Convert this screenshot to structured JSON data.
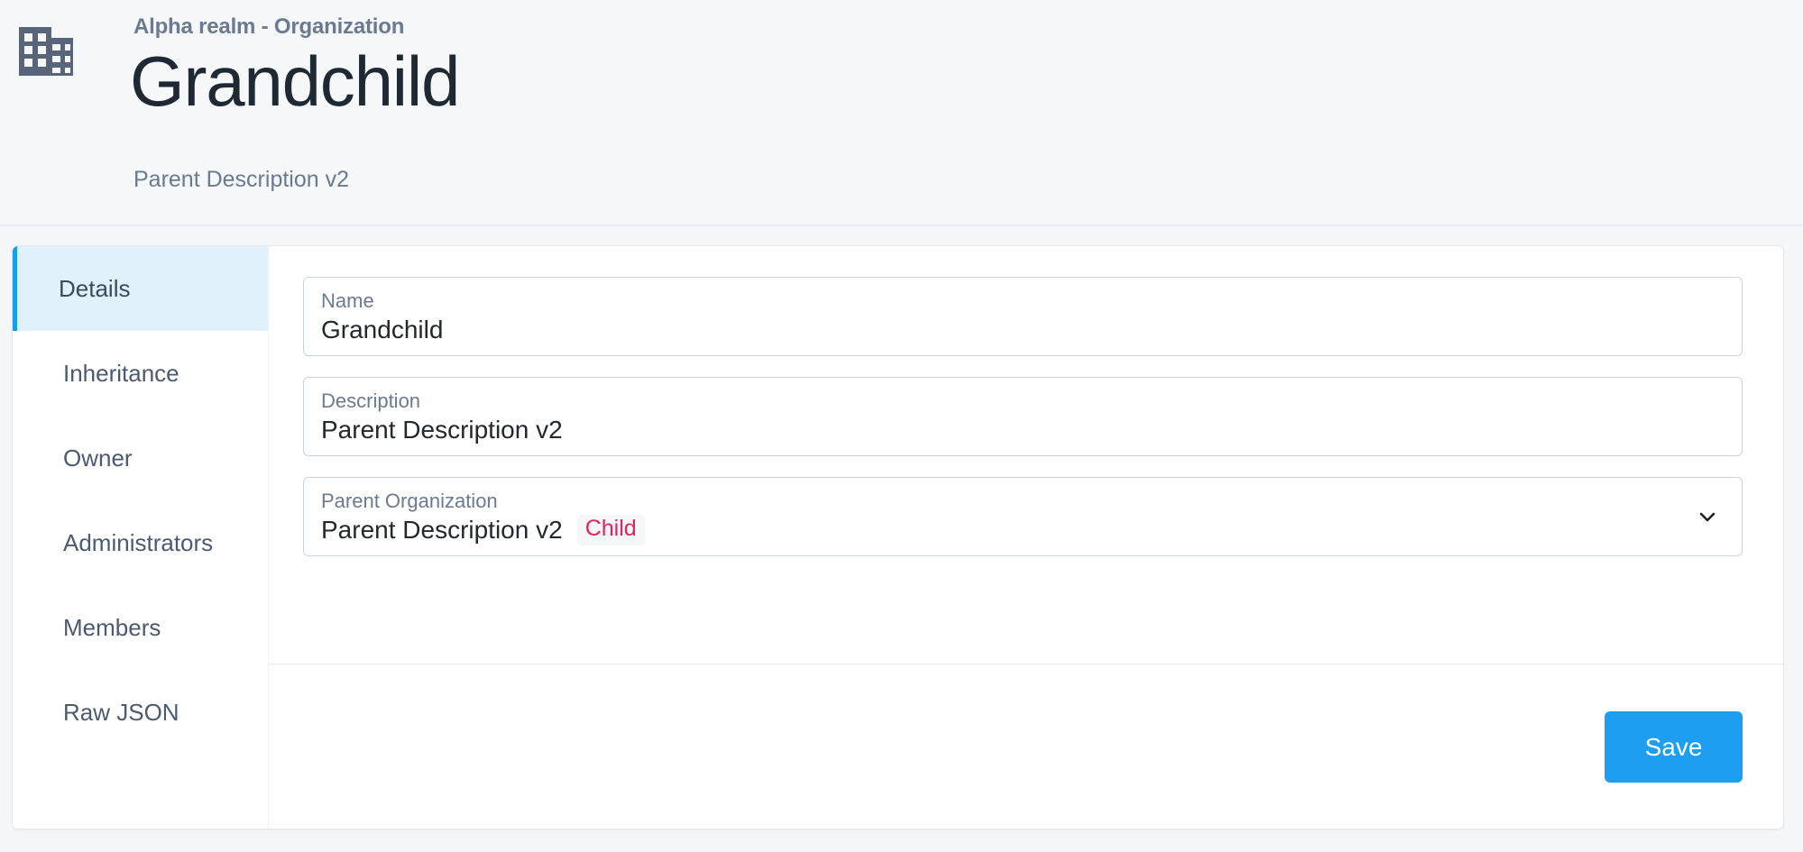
{
  "header": {
    "icon": "organization-building-icon",
    "breadcrumb": "Alpha realm - Organization",
    "title": "Grandchild",
    "subtitle": "Parent Description v2"
  },
  "sidebar": {
    "items": [
      {
        "label": "Details",
        "active": true
      },
      {
        "label": "Inheritance",
        "active": false
      },
      {
        "label": "Owner",
        "active": false
      },
      {
        "label": "Administrators",
        "active": false
      },
      {
        "label": "Members",
        "active": false
      },
      {
        "label": "Raw JSON",
        "active": false
      }
    ]
  },
  "form": {
    "name_field": {
      "label": "Name",
      "value": "Grandchild"
    },
    "description_field": {
      "label": "Description",
      "value": "Parent Description v2"
    },
    "parent_org_field": {
      "label": "Parent Organization",
      "value": "Parent Description v2",
      "badge": "Child",
      "dropdown_icon": "chevron-down-icon"
    }
  },
  "footer": {
    "save_label": "Save"
  },
  "colors": {
    "accent": "#189ded",
    "save_button": "#1e9ef0",
    "active_item_background": "#e1f1fb",
    "badge_text": "#e0245e",
    "label_text": "#6a7a90",
    "value_text": "#23272e",
    "page_background": "#f4f6f8"
  }
}
